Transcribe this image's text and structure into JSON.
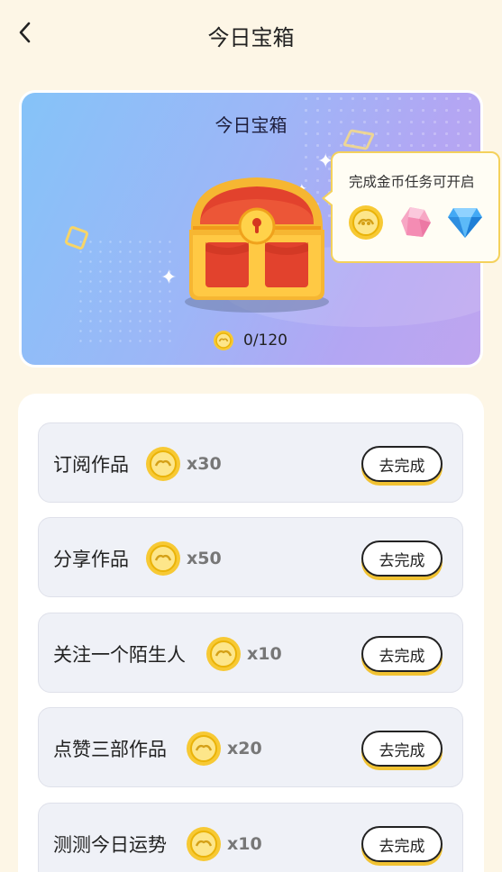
{
  "header": {
    "title": "今日宝箱"
  },
  "chest_card": {
    "title": "今日宝箱",
    "progress_text": "0/120",
    "progress_current": 0,
    "progress_total": 120,
    "tooltip_text": "完成金币任务可开启",
    "reward_icons": [
      "coin-icon",
      "pink-gem-icon",
      "blue-diamond-icon"
    ]
  },
  "tasks": [
    {
      "name": "订阅作品",
      "reward": "x30",
      "button": "去完成"
    },
    {
      "name": "分享作品",
      "reward": "x50",
      "button": "去完成"
    },
    {
      "name": "关注一个陌生人",
      "reward": "x10",
      "button": "去完成"
    },
    {
      "name": "点赞三部作品",
      "reward": "x20",
      "button": "去完成"
    },
    {
      "name": "测测今日运势",
      "reward": "x10",
      "button": "去完成"
    }
  ],
  "colors": {
    "background": "#fdf6e6",
    "accent_yellow": "#f1c232",
    "row_background": "#eff1f7"
  }
}
